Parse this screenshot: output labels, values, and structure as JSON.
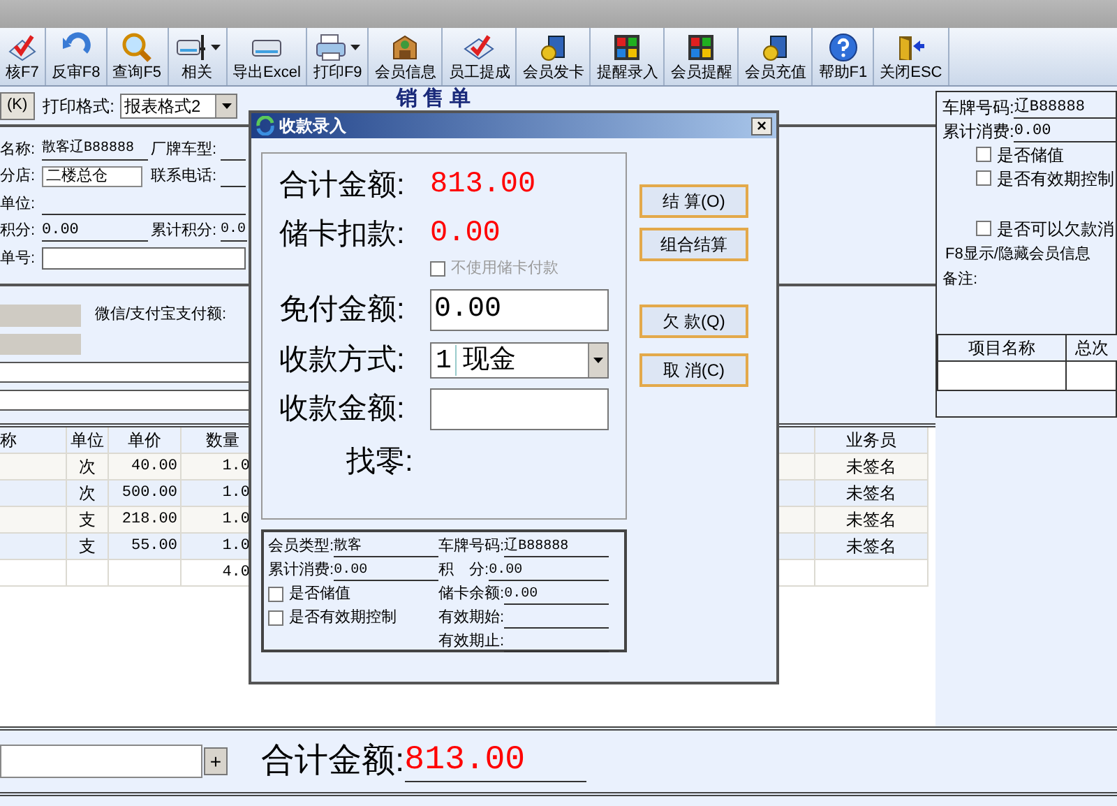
{
  "toolbar": [
    {
      "label": "核F7",
      "dropdown": false
    },
    {
      "label": "反审F8",
      "dropdown": false
    },
    {
      "label": "查询F5",
      "dropdown": false
    },
    {
      "label": "相关",
      "dropdown": true
    },
    {
      "label": "导出Excel",
      "dropdown": false
    },
    {
      "label": "打印F9",
      "dropdown": true
    },
    {
      "label": "会员信息",
      "dropdown": false
    },
    {
      "label": "员工提成",
      "dropdown": false
    },
    {
      "label": "会员发卡",
      "dropdown": false
    },
    {
      "label": "提醒录入",
      "dropdown": false
    },
    {
      "label": "会员提醒",
      "dropdown": false
    },
    {
      "label": "会员充值",
      "dropdown": false
    },
    {
      "label": "帮助F1",
      "dropdown": false
    },
    {
      "label": "关闭ESC",
      "dropdown": false
    }
  ],
  "sales_form": {
    "shortcut_button": "(K)",
    "print_format_label": "打印格式:",
    "print_format": "报表格式2",
    "title": "销售单",
    "customer": {
      "label": "名称:",
      "value": "散客辽B88888"
    },
    "car_model": {
      "label": "厂牌车型:"
    },
    "branch": {
      "label": "分店:",
      "value": "二楼总仓"
    },
    "phone": {
      "label": "联系电话:"
    },
    "unit": {
      "label": "单位:"
    },
    "points": {
      "label": "积分:",
      "value": "0.00"
    },
    "total_points": {
      "label": "累计积分:",
      "value": "0.0"
    },
    "order_no": {
      "label": "单号:"
    },
    "wechat_label": "微信/支付宝支付额:"
  },
  "items_table": {
    "columns": [
      "称",
      "单位",
      "单价",
      "数量",
      "业务员"
    ],
    "rows": [
      {
        "unit": "次",
        "price": "40.00",
        "qty": "1.0",
        "clerk": "未签名"
      },
      {
        "unit": "次",
        "price": "500.00",
        "qty": "1.0",
        "clerk": "未签名"
      },
      {
        "unit": "支",
        "price": "218.00",
        "qty": "1.0",
        "clerk": "未签名"
      },
      {
        "unit": "支",
        "price": "55.00",
        "qty": "1.0",
        "clerk": "未签名"
      }
    ],
    "total_qty": "4.0"
  },
  "member_panel": {
    "plate": {
      "label": "车牌号码:",
      "value": "辽B88888"
    },
    "spent": {
      "label": "累计消费:",
      "value": "0.00"
    },
    "options": [
      {
        "label": "是否储值",
        "checked": false
      },
      {
        "label": "是否有效期控制",
        "checked": false
      },
      {
        "label": "是否可以欠款消",
        "checked": false
      }
    ],
    "toggle_hint": "F8显示/隐藏会员信息",
    "note_label": "备注:",
    "table_columns": [
      "项目名称",
      "总次"
    ]
  },
  "bottom_bar": {
    "add_button": "+",
    "total_label": "合计金额:",
    "total": "813.00"
  },
  "dialog": {
    "title": "收款录入",
    "close": "×",
    "total": {
      "label": "合计金额:",
      "value": "813.00"
    },
    "card_deduction": {
      "label": "储卡扣款:",
      "value": "0.00"
    },
    "no_card": {
      "label": "不使用储卡付款",
      "checked": false,
      "disabled": true
    },
    "exempt": {
      "label": "免付金额:",
      "value": "0.00"
    },
    "method": {
      "label": "收款方式:",
      "code": "1",
      "value": "现金"
    },
    "received": {
      "label": "收款金额:"
    },
    "change": {
      "label": "找零:"
    },
    "buttons": [
      "结 算(O)",
      "组合结算",
      "欠 款(Q)",
      "取 消(C)"
    ],
    "member": {
      "type": {
        "label": "会员类型:",
        "value": "散客"
      },
      "plate": {
        "label": "车牌号码:",
        "value": "辽B88888"
      },
      "spent": {
        "label": "累计消费:",
        "value": "0.00"
      },
      "points": {
        "label": "积　分:",
        "value": "0.00"
      },
      "options": [
        {
          "label": "是否储值",
          "checked": false
        },
        {
          "label": "是否有效期控制",
          "checked": false
        }
      ],
      "balance": {
        "label": "储卡余额:",
        "value": "0.00"
      },
      "valid_from": {
        "label": "有效期始:"
      },
      "valid_to": {
        "label": "有效期止:"
      }
    }
  }
}
